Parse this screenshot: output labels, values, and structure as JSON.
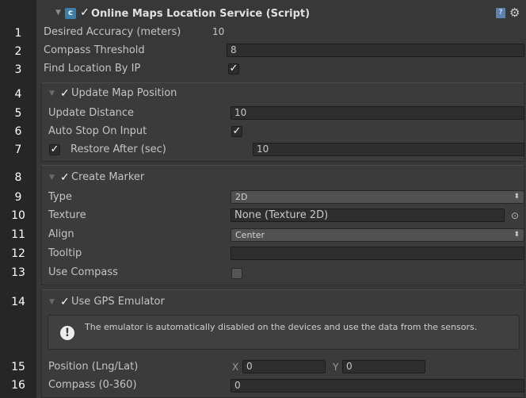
{
  "component": {
    "title": "Online Maps Location Service (Script)",
    "enabled_mark": "✓",
    "icon": "script-cs-icon",
    "help_icon": "help-book-icon",
    "settings_icon": "gear-icon"
  },
  "line_numbers": [
    "1",
    "2",
    "3",
    "4",
    "5",
    "6",
    "7",
    "8",
    "9",
    "10",
    "11",
    "12",
    "13",
    "14",
    "15",
    "16"
  ],
  "fields": {
    "desired_accuracy": {
      "label": "Desired Accuracy (meters)",
      "value": "10"
    },
    "compass_threshold": {
      "label": "Compass Threshold",
      "value": "8"
    },
    "find_location_by_ip": {
      "label": "Find Location By IP",
      "checked": true
    },
    "update_map_position": {
      "label": "Update Map Position",
      "checked": true
    },
    "update_distance": {
      "label": "Update Distance",
      "value": "10"
    },
    "auto_stop_on_input": {
      "label": "Auto Stop On Input",
      "checked": true
    },
    "restore_after": {
      "label": "Restore After (sec)",
      "checked": true,
      "value": "10"
    },
    "create_marker": {
      "label": "Create Marker",
      "checked": true
    },
    "type": {
      "label": "Type",
      "value": "2D"
    },
    "texture": {
      "label": "Texture",
      "value": "None (Texture 2D)"
    },
    "align": {
      "label": "Align",
      "value": "Center"
    },
    "tooltip": {
      "label": "Tooltip",
      "value": ""
    },
    "use_compass": {
      "label": "Use Compass",
      "checked": false
    },
    "use_gps_emulator": {
      "label": "Use GPS Emulator",
      "checked": true
    },
    "emulator_help": "The emulator is automatically disabled on the devices and use the data from the sensors.",
    "position": {
      "label": "Position (Lng/Lat)",
      "x_label": "X",
      "x_value": "0",
      "y_label": "Y",
      "y_value": "0"
    },
    "compass": {
      "label": "Compass (0-360)",
      "value": "0"
    }
  },
  "glyphs": {
    "check": "✓",
    "foldout": "▼",
    "dropdown_arrow": "⬍",
    "object_picker": "⊙",
    "info": "!"
  }
}
